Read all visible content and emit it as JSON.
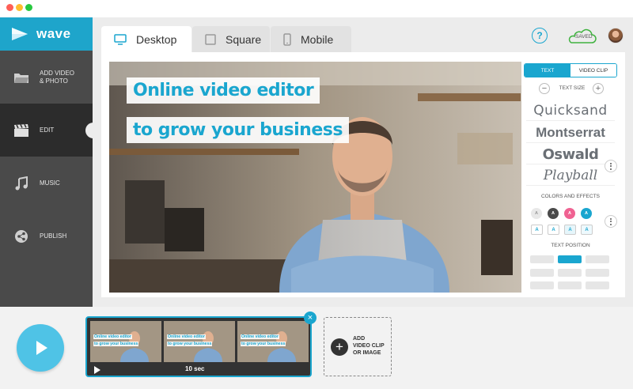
{
  "app": {
    "brand": "wave"
  },
  "window": {
    "dots": [
      "#ff5f57",
      "#ffbd2e",
      "#28c840"
    ]
  },
  "sidebar": {
    "items": [
      {
        "label_line1": "ADD VIDEO",
        "label_line2": "& PHOTO",
        "icon": "folder-icon"
      },
      {
        "label_line1": "EDIT",
        "label_line2": "",
        "icon": "clapperboard-icon",
        "active": true
      },
      {
        "label_line1": "MUSIC",
        "label_line2": "",
        "icon": "music-icon"
      },
      {
        "label_line1": "PUBLISH",
        "label_line2": "",
        "icon": "share-icon"
      }
    ]
  },
  "format_tabs": [
    {
      "label": "Desktop",
      "icon": "desktop-icon",
      "active": true
    },
    {
      "label": "Square",
      "icon": "square-icon"
    },
    {
      "label": "Mobile",
      "icon": "mobile-icon"
    }
  ],
  "header": {
    "help": "?",
    "saved_label": "SAVED"
  },
  "preview": {
    "caption_line1": "Online video editor",
    "caption_line2": "to grow your business"
  },
  "panel": {
    "tabs": [
      "TEXT",
      "VIDEO CLIP"
    ],
    "text_size_label": "TEXT SIZE",
    "minus": "−",
    "plus": "+",
    "fonts": [
      "Quicksand",
      "Montserrat",
      "Oswald",
      "Playball"
    ],
    "colors_label": "COLORS AND EFFECTS",
    "swatches": [
      {
        "letter": "A",
        "bg": "#e8e8e8",
        "fg": "#999999"
      },
      {
        "letter": "A",
        "bg": "#4a4a4a",
        "fg": "#ffffff"
      },
      {
        "letter": "A",
        "bg": "#f06292",
        "fg": "#ffffff"
      },
      {
        "letter": "A",
        "bg": "#1aa6cf",
        "fg": "#ffffff"
      }
    ],
    "effects": [
      "A",
      "A",
      "A",
      "A"
    ],
    "text_position_label": "TEXT POSITION",
    "accent": "#1aa6cf"
  },
  "timeline": {
    "duration": "10 sec",
    "thumb_caption1": "Online video editor",
    "thumb_caption2": "to grow your business",
    "add_line1": "ADD",
    "add_line2": "VIDEO CLIP",
    "add_line3": "OR IMAGE",
    "close": "×",
    "add_plus": "+"
  }
}
